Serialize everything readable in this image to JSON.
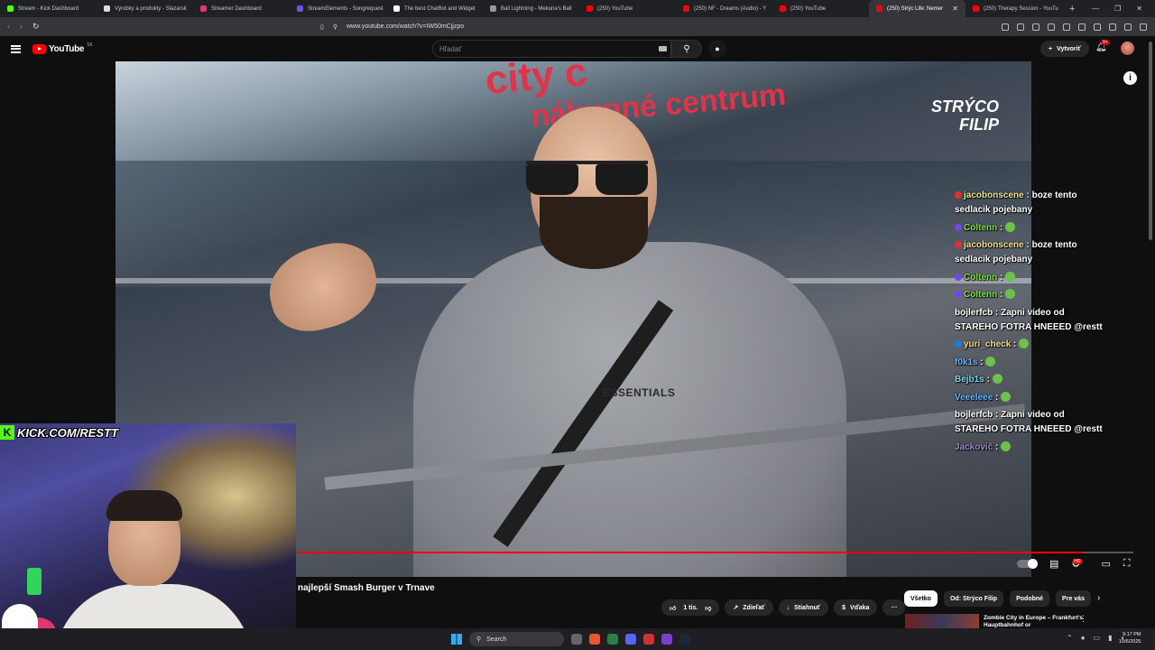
{
  "browser": {
    "tabs": [
      {
        "label": "Stream - Kick Dashboard",
        "color": "#53fc18"
      },
      {
        "label": "Výrobky a produkty - Slazarsk",
        "color": "#dddddd"
      },
      {
        "label": "Streamer Dashboard",
        "color": "#e0386a"
      },
      {
        "label": "StreamElements - Songrequest",
        "color": "#6c4dff"
      },
      {
        "label": "The best ChatBot and Widget",
        "color": "#ffffff"
      },
      {
        "label": "Ball Lightning - Mekuna's Ball",
        "color": "#999999"
      },
      {
        "label": "(250) YouTube",
        "color": "#ff0000"
      },
      {
        "label": "(250) NF - Dreams (Audio) - Y",
        "color": "#ff0000"
      },
      {
        "label": "(250) YouTube",
        "color": "#ff0000"
      },
      {
        "label": "(250) Strýc Life: Nemer",
        "color": "#ff0000",
        "active": true
      },
      {
        "label": "(250) Therapy Session - YouTu",
        "color": "#ff0000"
      }
    ],
    "new_tab": "+",
    "url": "www.youtube.com/watch?v=IW50mCjjzpo"
  },
  "youtube": {
    "logo_text": "YouTube",
    "region": "SK",
    "search_placeholder": "Hľadať",
    "create_label": "Vytvoriť",
    "notif_count": "9+"
  },
  "video": {
    "sign_line1": "city c",
    "sign_line2": "nákupné centrum",
    "watermark_line1": "STRÝCO",
    "watermark_line2": "FILIP",
    "shirt_brand": "ESSENTIALS",
    "progress": 0.94
  },
  "chat": [
    {
      "user": "jacobonscene",
      "text": "boze tento sedlacik pojebany",
      "color": "y"
    },
    {
      "user": "Coltenn",
      "text": "",
      "color": "g",
      "emote": true
    },
    {
      "user": "jacobonscene",
      "text": "boze tento sedlacik pojebany",
      "color": "y"
    },
    {
      "user": "Coltenn",
      "text": "",
      "color": "g",
      "emote": true
    },
    {
      "user": "Coltenn",
      "text": "",
      "color": "g",
      "emote": true
    },
    {
      "user": "bojlerfcb",
      "text": "Zapni video od STAREHO FOTRA HNEEED @restt",
      "color": "w"
    },
    {
      "user": "yuri_check",
      "text": "",
      "color": "y",
      "emote": true
    },
    {
      "user": "f0k1s",
      "text": "",
      "color": "b",
      "emote": true
    },
    {
      "user": "Bejb1s",
      "text": "",
      "color": "t",
      "emote": true
    },
    {
      "user": "Veeeleee",
      "text": "",
      "color": "b",
      "emote": true
    },
    {
      "user": "bojlerfcb",
      "text": "Zapni video od STAREHO FOTRA HNEEED @restt",
      "color": "w"
    },
    {
      "user": "Jackovič",
      "text": "",
      "color": "p",
      "emote": true
    }
  ],
  "overlay": {
    "kick_label": "KICK.COM/RESTT",
    "kick_letter": "K"
  },
  "below": {
    "title": "najlepší Smash Burger v Trnave",
    "like_count": "1 tis.",
    "share_label": "Zdieľať",
    "download_label": "Stiahnuť",
    "thanks_label": "Vďaka",
    "more": "···"
  },
  "chips": [
    "Všetko",
    "Od: Strýco Filip",
    "Podobné",
    "Pre vás"
  ],
  "recommendation": {
    "title": "Zombie City in Europe – Frankfurt's Hauptbahnhof or"
  },
  "taskbar": {
    "search_label": "Search",
    "time": "9:17 PM",
    "date": "10/6/2025"
  }
}
